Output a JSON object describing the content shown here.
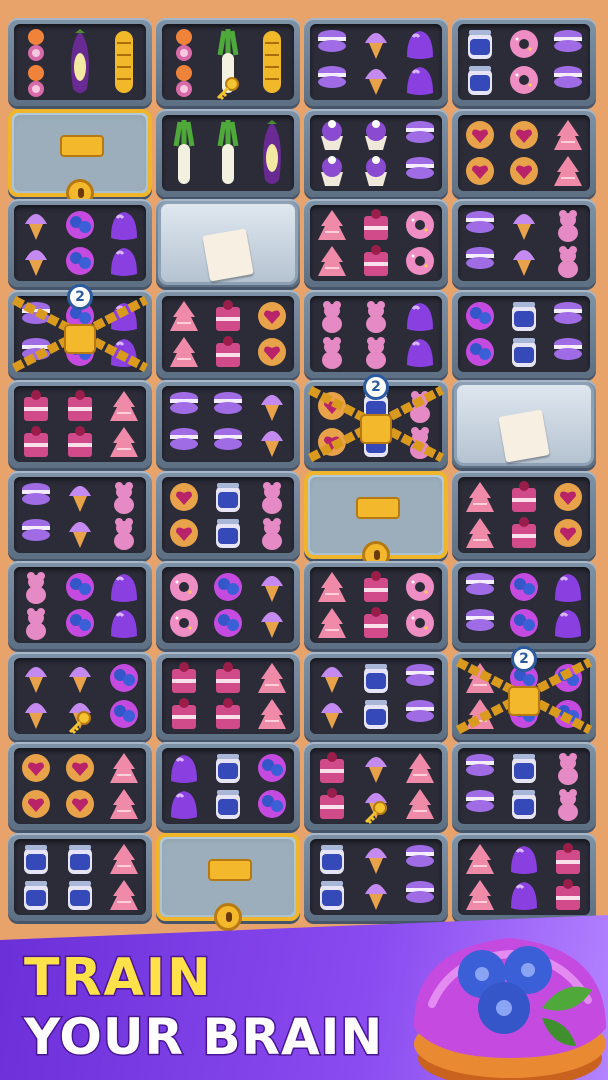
{
  "screen": {
    "title_line1": "TRAIN",
    "title_line2": "YOUR BRAIN",
    "accent_colors": {
      "banner": "#7b3fe4",
      "title_yellow": "#ffe14a",
      "background": "#e8a36b",
      "lock_gold": "#f4b82c"
    }
  },
  "board": {
    "columns": 4,
    "rows": 10,
    "shelves": [
      {
        "items": [
          "onion",
          "eggplant",
          "corn"
        ]
      },
      {
        "items": [
          "onion",
          "leek",
          "corn"
        ],
        "key": true
      },
      {
        "items": [
          "macaron",
          "ice-cream",
          "jelly"
        ]
      },
      {
        "items": [
          "jam-jar",
          "donut",
          "macaron"
        ]
      },
      {
        "items": [],
        "lock": "glass"
      },
      {
        "items": [
          "leek",
          "leek",
          "eggplant"
        ]
      },
      {
        "items": [
          "cupcake",
          "cupcake",
          "macaron"
        ]
      },
      {
        "items": [
          "heart-cookie",
          "heart-cookie",
          "watermelon-cake"
        ]
      },
      {
        "items": [
          "ice-cream",
          "blueberry-donut",
          "jelly"
        ]
      },
      {
        "items": [],
        "lock": "crate",
        "tag_icon": "jam-jar-icon"
      },
      {
        "items": [
          "watermelon-cake",
          "berry-cake",
          "donut"
        ]
      },
      {
        "items": [
          "macaron",
          "ice-cream",
          "gummy-bear"
        ]
      },
      {
        "items": [
          "macaron",
          "blueberry-donut",
          "jelly"
        ],
        "lock": "chain",
        "chain_count": "2"
      },
      {
        "items": [
          "watermelon-cake",
          "berry-cake",
          "heart-cookie"
        ]
      },
      {
        "items": [
          "gummy-bear",
          "gummy-bear",
          "jelly"
        ]
      },
      {
        "items": [
          "blueberry-donut",
          "jam-jar",
          "macaron"
        ]
      },
      {
        "items": [
          "berry-cake",
          "berry-cake",
          "watermelon-cake"
        ]
      },
      {
        "items": [
          "macaron",
          "macaron",
          "ice-cream"
        ]
      },
      {
        "items": [
          "heart-cookie",
          "jam-jar",
          "gummy-bear"
        ],
        "lock": "chain",
        "chain_count": "2"
      },
      {
        "items": [],
        "lock": "crate",
        "tag_icon": "ice-cream-icon"
      },
      {
        "items": [
          "macaron",
          "ice-cream",
          "gummy-bear"
        ]
      },
      {
        "items": [
          "heart-cookie",
          "jam-jar",
          "gummy-bear"
        ]
      },
      {
        "items": [],
        "lock": "glass"
      },
      {
        "items": [
          "watermelon-cake",
          "berry-cake",
          "heart-cookie"
        ]
      },
      {
        "items": [
          "gummy-bear",
          "blueberry-donut",
          "jelly"
        ]
      },
      {
        "items": [
          "donut",
          "blueberry-donut",
          "ice-cream"
        ]
      },
      {
        "items": [
          "watermelon-cake",
          "berry-cake",
          "donut"
        ]
      },
      {
        "items": [
          "macaron",
          "blueberry-donut",
          "jelly"
        ]
      },
      {
        "items": [
          "ice-cream",
          "ice-cream",
          "blueberry-donut"
        ],
        "key": true
      },
      {
        "items": [
          "berry-cake",
          "berry-cake",
          "watermelon-cake"
        ]
      },
      {
        "items": [
          "ice-cream",
          "jam-jar",
          "macaron"
        ]
      },
      {
        "items": [
          "watermelon-cake",
          "blueberry-donut",
          "blueberry-donut"
        ],
        "lock": "chain",
        "chain_count": "2"
      },
      {
        "items": [
          "heart-cookie",
          "heart-cookie",
          "watermelon-cake"
        ]
      },
      {
        "items": [
          "jelly",
          "jam-jar",
          "blueberry-donut"
        ]
      },
      {
        "items": [
          "berry-cake",
          "ice-cream",
          "watermelon-cake"
        ],
        "key": true
      },
      {
        "items": [
          "macaron",
          "jam-jar",
          "gummy-bear"
        ]
      },
      {
        "items": [
          "jam-jar",
          "jam-jar",
          "watermelon-cake"
        ]
      },
      {
        "items": [],
        "lock": "glass"
      },
      {
        "items": [
          "jam-jar",
          "ice-cream",
          "macaron"
        ]
      },
      {
        "items": [
          "watermelon-cake",
          "jelly",
          "berry-cake"
        ]
      }
    ]
  },
  "hero_item": "blueberry-muffin-icon"
}
